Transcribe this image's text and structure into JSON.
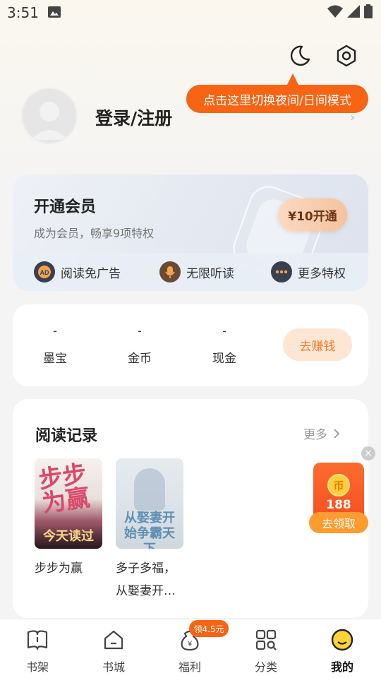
{
  "status_bar": {
    "time": "3:51"
  },
  "tooltip": {
    "text": "点击这里切换夜间/日间模式"
  },
  "profile": {
    "login_text": "登录/注册"
  },
  "vip": {
    "title": "开通会员",
    "subtitle": "成为会员，畅享9项特权",
    "button": "¥10开通",
    "perks": [
      {
        "label": "阅读免广告",
        "icon": "ad-icon"
      },
      {
        "label": "无限听读",
        "icon": "microphone-icon"
      },
      {
        "label": "更多特权",
        "icon": "more-dots-icon"
      }
    ]
  },
  "wallet": {
    "items": [
      {
        "value": "-",
        "label": "墨宝"
      },
      {
        "value": "-",
        "label": "金币"
      },
      {
        "value": "-",
        "label": "现金"
      }
    ],
    "earn_button": "去赚钱"
  },
  "history": {
    "title": "阅读记录",
    "more": "更多",
    "books": [
      {
        "title": "步步为赢",
        "cover_text": "步步为赢",
        "badge": "今天读过"
      },
      {
        "title": "多子多福，从娶妻开…",
        "cover_text": "从娶妻开始争霸天下"
      }
    ]
  },
  "floating_reward": {
    "amount": "188",
    "button": "去领取"
  },
  "tabbar": {
    "badge": "领4.5元",
    "tabs": [
      {
        "label": "书架",
        "icon": "bookshelf-icon"
      },
      {
        "label": "书城",
        "icon": "home-icon"
      },
      {
        "label": "福利",
        "icon": "welfare-icon"
      },
      {
        "label": "分类",
        "icon": "category-icon"
      },
      {
        "label": "我的",
        "icon": "profile-icon",
        "active": true
      }
    ]
  },
  "colors": {
    "accent": "#f76414",
    "earn": "#ee7d2e",
    "vip_button": "#f6c29d"
  }
}
